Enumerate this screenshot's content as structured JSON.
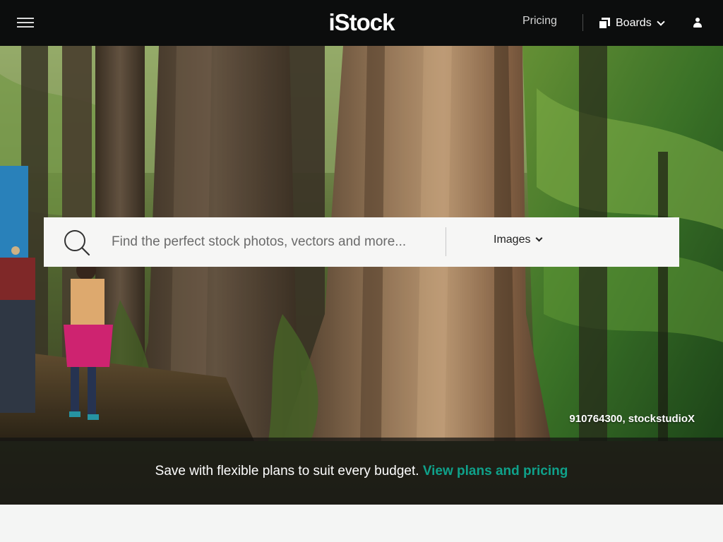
{
  "header": {
    "logo_text": "iStock",
    "pricing_label": "Pricing",
    "boards_label": "Boards"
  },
  "icons": {
    "menu": "hamburger-menu-icon",
    "boards": "boards-icon",
    "boards_chevron": "chevron-down-icon",
    "user": "user-icon",
    "search": "search-icon",
    "type_chevron": "chevron-down-icon"
  },
  "hero": {
    "search_placeholder": "Find the perfect stock photos, vectors and more...",
    "search_value": "",
    "search_type_selected": "Images",
    "credit": "910764300, stockstudioX"
  },
  "promo": {
    "text": "Save with flexible plans to suit every budget.",
    "link_text": "View plans and pricing"
  },
  "colors": {
    "header_bg": "#0c0d0d",
    "accent_link": "#0fa18a",
    "page_bg": "#f4f5f4"
  }
}
